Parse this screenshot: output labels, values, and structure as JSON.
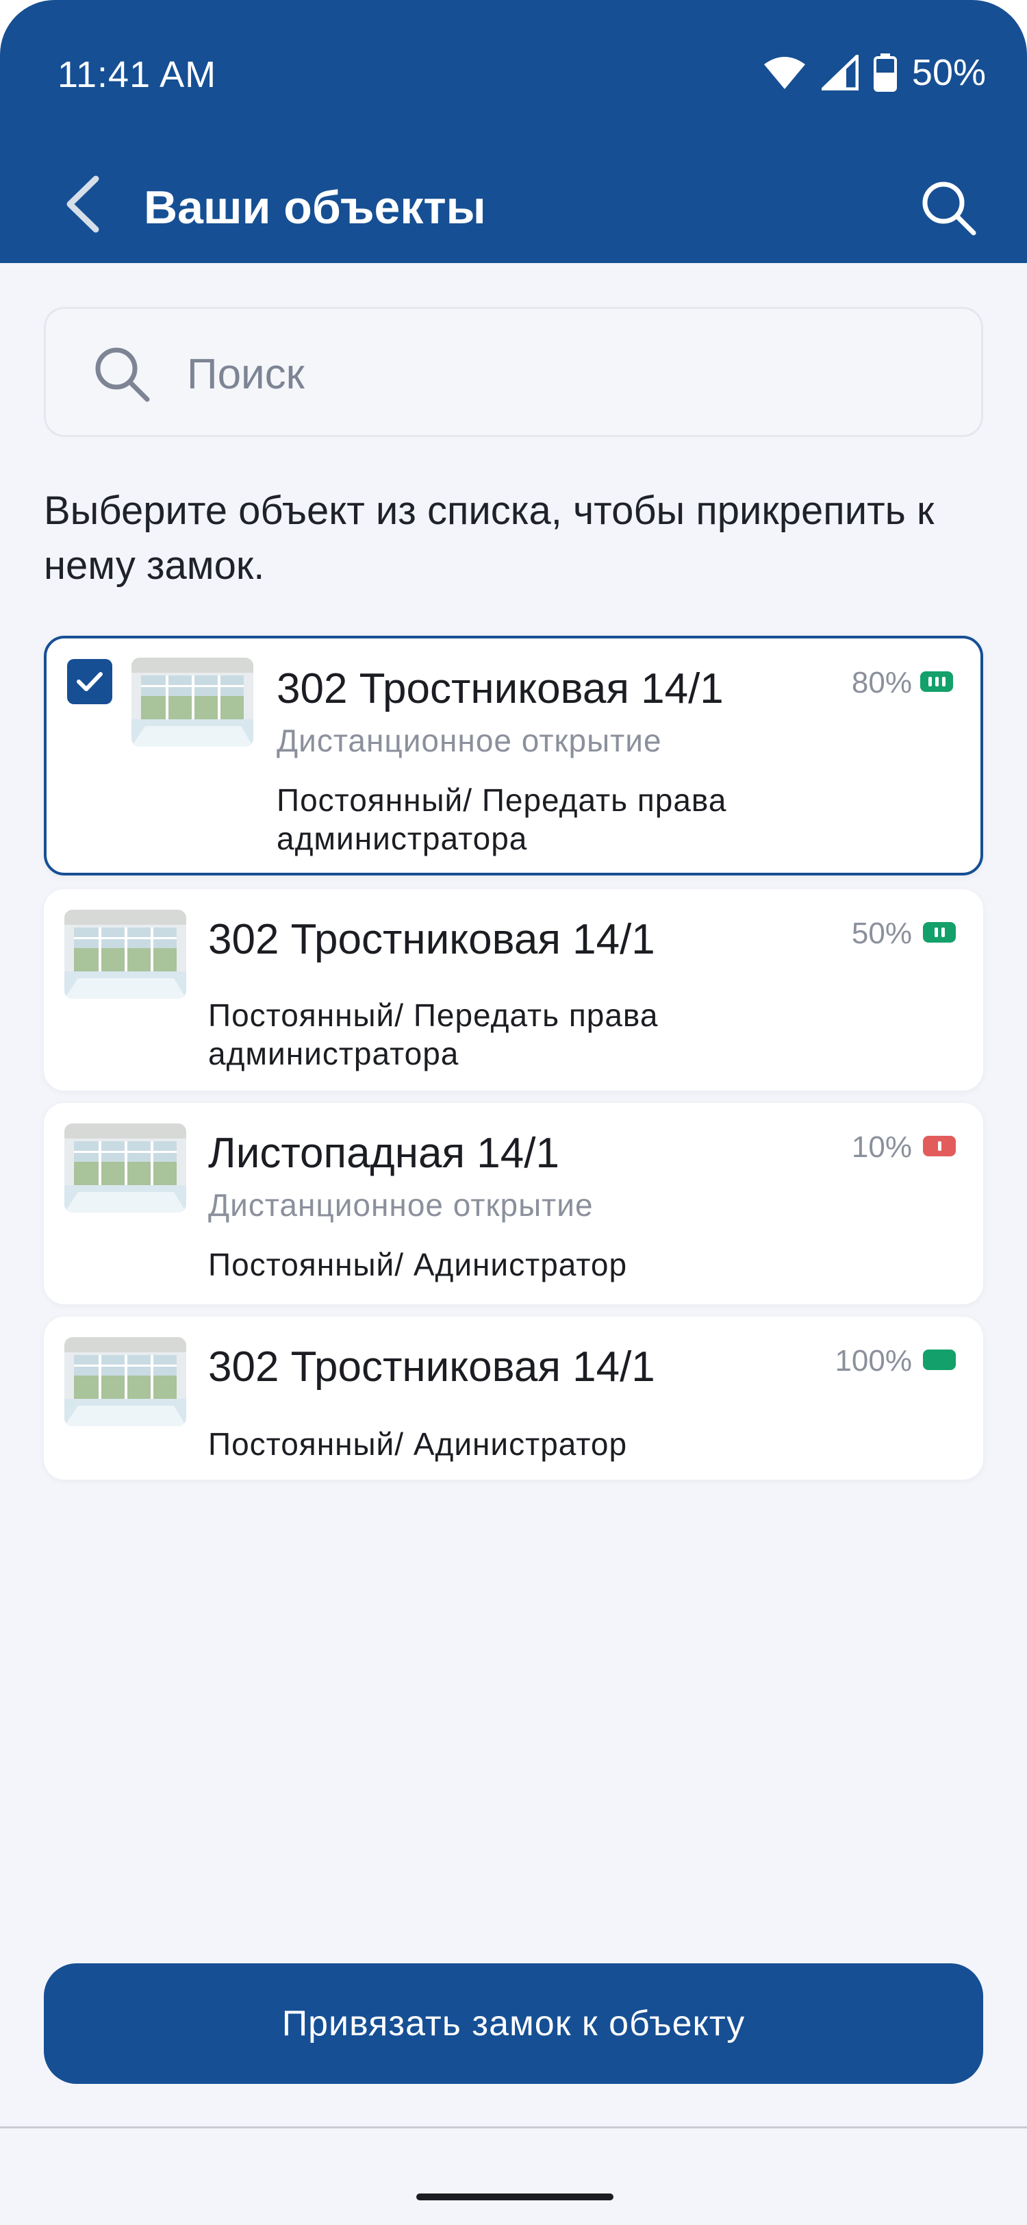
{
  "status_bar": {
    "time": "11:41 AM",
    "battery": "50%"
  },
  "header": {
    "title": "Ваши объекты"
  },
  "search": {
    "placeholder": "Поиск"
  },
  "instruction": "Выберите объект из списка, чтобы прикрепить к нему замок.",
  "objects": [
    {
      "title": "302 Тростниковая 14/1",
      "subtitle": "Дистанционное открытие",
      "role": "Постоянный/ Передать права администратора",
      "battery": "80%",
      "battery_color": "#14a06b",
      "selected": true
    },
    {
      "title": "302 Тростниковая 14/1",
      "subtitle": "",
      "role": "Постоянный/ Передать права администратора",
      "battery": "50%",
      "battery_color": "#14a06b",
      "selected": false
    },
    {
      "title": "Листопадная 14/1",
      "subtitle": "Дистанционное открытие",
      "role": "Постоянный/ Адинистратор",
      "battery": "10%",
      "battery_color": "#e25c5c",
      "selected": false
    },
    {
      "title": "302 Тростниковая 14/1",
      "subtitle": "",
      "role": "Постоянный/ Адинистратор",
      "battery": "100%",
      "battery_color": "#14a06b",
      "selected": false
    }
  ],
  "bind_button": {
    "label": "Привязать замок к объекту"
  },
  "colors": {
    "primary": "#164f94",
    "background": "#f3f5fa"
  }
}
